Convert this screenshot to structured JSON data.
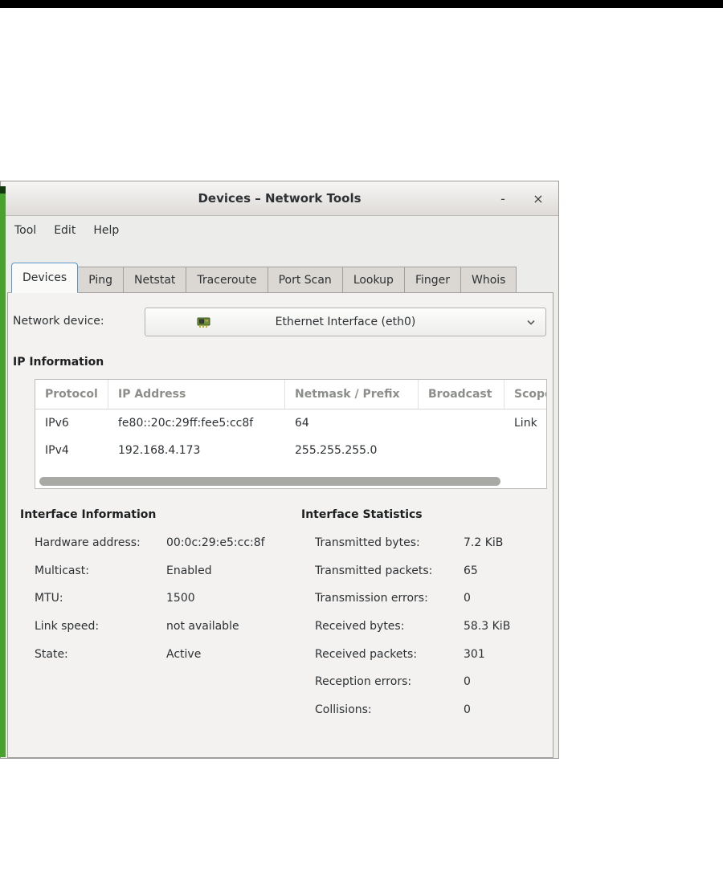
{
  "colors": {
    "accent_blue": "#5a95cc",
    "background_strip_green": "#4aa22e"
  },
  "window": {
    "title": "Devices – Network Tools",
    "controls": {
      "minimize": "-",
      "close": "×"
    },
    "menu": {
      "items": [
        "Tool",
        "Edit",
        "Help"
      ]
    },
    "tabs": {
      "items": [
        "Devices",
        "Ping",
        "Netstat",
        "Traceroute",
        "Port Scan",
        "Lookup",
        "Finger",
        "Whois"
      ],
      "active": "Devices"
    }
  },
  "device_selector": {
    "label": "Network device:",
    "value": "Ethernet Interface (eth0)",
    "icon": "ethernet-device-icon"
  },
  "ip_information": {
    "title": "IP Information",
    "columns": [
      "Protocol",
      "IP Address",
      "Netmask / Prefix",
      "Broadcast",
      "Scope"
    ],
    "rows": [
      {
        "protocol": "IPv6",
        "ip": "fe80::20c:29ff:fee5:cc8f",
        "netmask": "64",
        "broadcast": "",
        "scope": "Link"
      },
      {
        "protocol": "IPv4",
        "ip": "192.168.4.173",
        "netmask": "255.255.255.0",
        "broadcast": "",
        "scope": ""
      }
    ]
  },
  "interface_information": {
    "title": "Interface Information",
    "rows": [
      {
        "label": "Hardware address:",
        "value": "00:0c:29:e5:cc:8f"
      },
      {
        "label": "Multicast:",
        "value": "Enabled"
      },
      {
        "label": "MTU:",
        "value": "1500"
      },
      {
        "label": "Link speed:",
        "value": "not available"
      },
      {
        "label": "State:",
        "value": "Active"
      }
    ]
  },
  "interface_statistics": {
    "title": "Interface Statistics",
    "rows": [
      {
        "label": "Transmitted bytes:",
        "value": "7.2 KiB"
      },
      {
        "label": "Transmitted packets:",
        "value": "65"
      },
      {
        "label": "Transmission errors:",
        "value": "0"
      },
      {
        "label": "Received bytes:",
        "value": "58.3 KiB"
      },
      {
        "label": "Received packets:",
        "value": "301"
      },
      {
        "label": "Reception errors:",
        "value": "0"
      },
      {
        "label": "Collisions:",
        "value": "0"
      }
    ]
  }
}
